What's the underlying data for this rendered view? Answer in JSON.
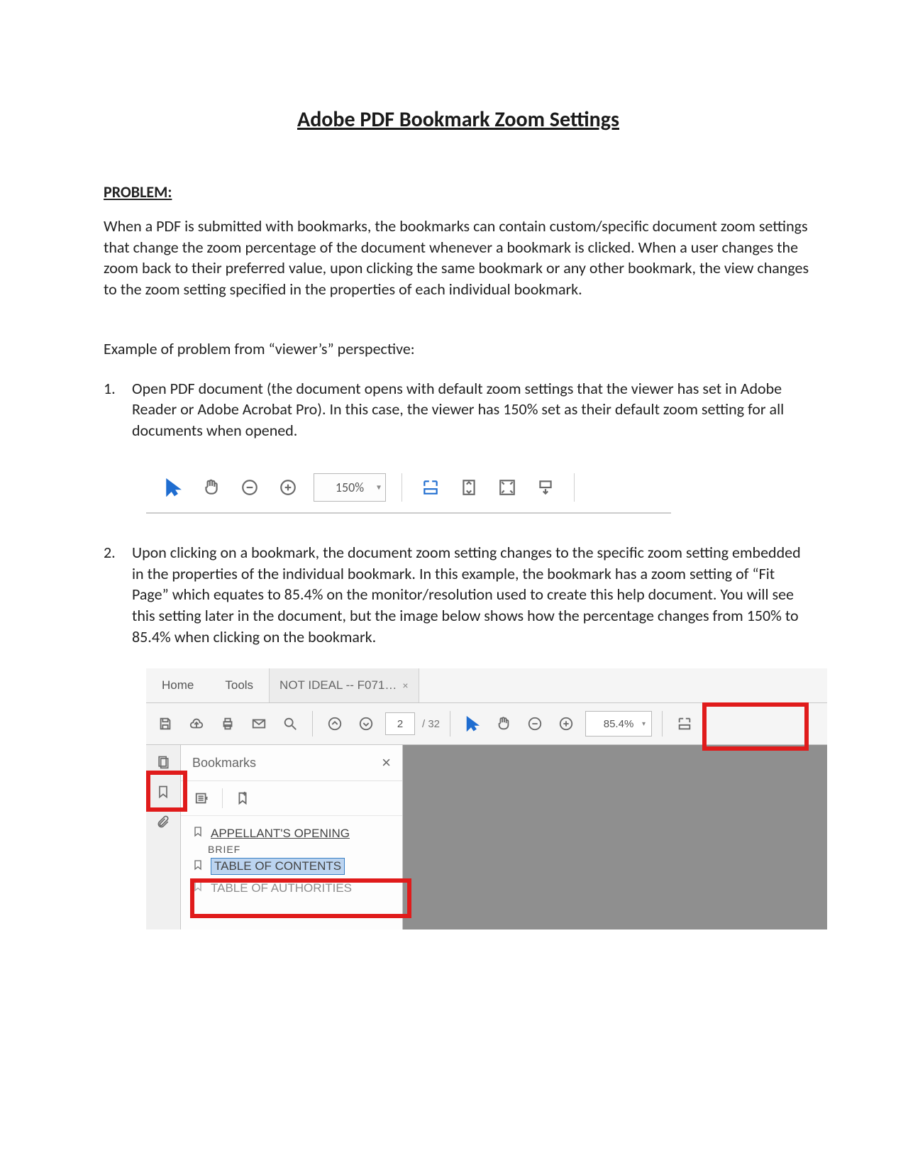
{
  "title": "Adobe PDF Bookmark Zoom Settings",
  "problem_heading": "PROBLEM:",
  "problem_text": "When a PDF is submitted with bookmarks, the bookmarks can contain custom/specific document zoom settings that change the zoom percentage of the document whenever a bookmark is clicked.  When a user changes the zoom back to their preferred value, upon clicking the same bookmark or any other bookmark, the view changes to the zoom setting specified in the properties of each individual bookmark.",
  "example_intro": "Example of problem from “viewer’s” perspective:",
  "steps": [
    {
      "n": "1.",
      "text": "Open PDF document (the document opens with default zoom settings that the viewer has set in Adobe Reader or Adobe Acrobat Pro).  In this case, the viewer has 150% set as their default zoom setting for all documents when opened."
    },
    {
      "n": "2.",
      "text": "Upon clicking on a bookmark, the document zoom setting changes to the specific zoom setting embedded in the properties of the individual bookmark.  In this example, the bookmark has a zoom setting of “Fit Page” which equates to 85.4% on the monitor/resolution used to create this help document.  You will see this setting later in the document, but the image below shows how the percentage changes from 150% to 85.4% when clicking on the bookmark."
    }
  ],
  "shot1": {
    "zoom": "150%"
  },
  "shot2": {
    "tab_home": "Home",
    "tab_tools": "Tools",
    "doc_tab": "NOT IDEAL -- F071…",
    "doc_tab_close": "×",
    "page_current": "2",
    "page_total": "/ 32",
    "zoom": "85.4%",
    "panel_title": "Bookmarks",
    "panel_close": "×",
    "bm1": "APPELLANT'S OPENING",
    "bm1_sub": "BRIEF",
    "bm2": "TABLE OF CONTENTS",
    "bm3": "TABLE OF AUTHORITIES"
  }
}
